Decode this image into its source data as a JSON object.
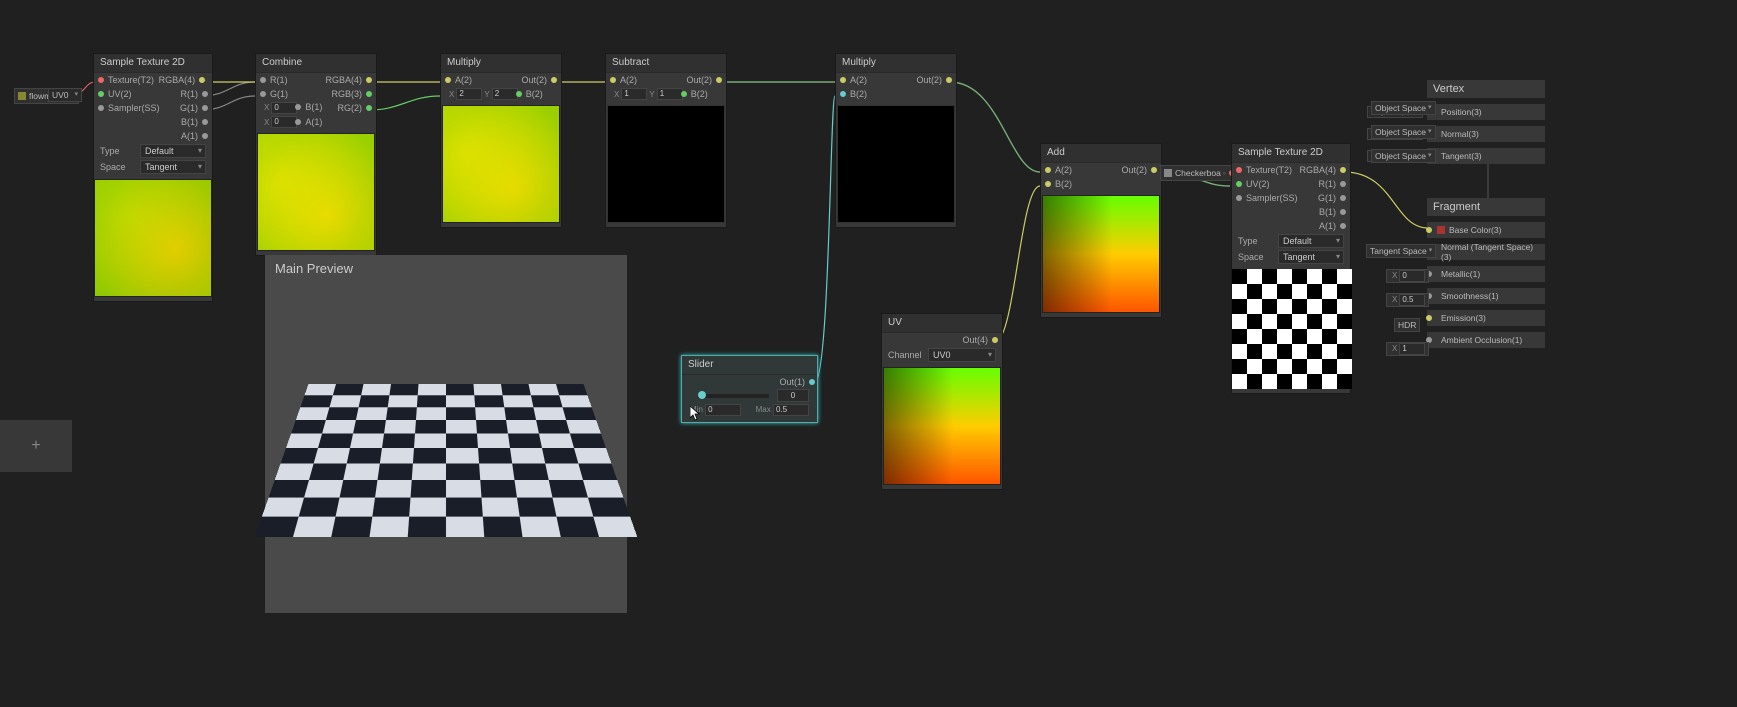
{
  "property_chip": {
    "label": "flowmap",
    "dd": "UV0"
  },
  "nodes": {
    "sample1": {
      "title": "Sample Texture 2D",
      "ports_in": [
        "Texture(T2)",
        "UV(2)",
        "Sampler(SS)"
      ],
      "ports_out": [
        "RGBA(4)",
        "R(1)",
        "G(1)",
        "B(1)",
        "A(1)"
      ],
      "type_lbl": "Type",
      "type_val": "Default",
      "space_lbl": "Space",
      "space_val": "Tangent"
    },
    "combine": {
      "title": "Combine",
      "ports_in": [
        "R(1)",
        "G(1)",
        "B(1)",
        "A(1)"
      ],
      "ports_out": [
        "RGBA(4)",
        "RGB(3)",
        "RG(2)"
      ],
      "x_lbl": "X",
      "x_val": "0"
    },
    "mul1": {
      "title": "Multiply",
      "ports_in": [
        "A(2)",
        "B(2)"
      ],
      "ports_out": [
        "Out(2)"
      ],
      "x_lbl": "X",
      "x_val": "2",
      "y_lbl": "Y",
      "y_val": "2"
    },
    "sub": {
      "title": "Subtract",
      "ports_in": [
        "A(2)",
        "B(2)"
      ],
      "ports_out": [
        "Out(2)"
      ],
      "x_lbl": "X",
      "x_val": "1",
      "y_lbl": "Y",
      "y_val": "1"
    },
    "mul2": {
      "title": "Multiply",
      "ports_in": [
        "A(2)",
        "B(2)"
      ],
      "ports_out": [
        "Out(2)"
      ]
    },
    "add": {
      "title": "Add",
      "ports_in": [
        "A(2)",
        "B(2)"
      ],
      "ports_out": [
        "Out(2)"
      ]
    },
    "uv": {
      "title": "UV",
      "ports_out": [
        "Out(4)"
      ],
      "channel_lbl": "Channel",
      "channel_val": "UV0"
    },
    "slider": {
      "title": "Slider",
      "out_lbl": "Out(1)",
      "value": "0",
      "min_lbl": "Min",
      "min_val": "0",
      "max_lbl": "Max",
      "max_val": "0.5"
    },
    "sample2": {
      "title": "Sample Texture 2D",
      "ports_in": [
        "Texture(T2)",
        "UV(2)",
        "Sampler(SS)"
      ],
      "ports_out": [
        "RGBA(4)",
        "R(1)",
        "G(1)",
        "B(1)",
        "A(1)"
      ],
      "type_lbl": "Type",
      "type_val": "Default",
      "space_lbl": "Space",
      "space_val": "Tangent"
    },
    "checker_chip": {
      "label": "Checkerboa"
    }
  },
  "vertex": {
    "title": "Vertex",
    "rows": [
      {
        "chip": "Object Space",
        "label": "Position(3)"
      },
      {
        "chip": "Object Space",
        "label": "Normal(3)"
      },
      {
        "chip": "Object Space",
        "label": "Tangent(3)"
      }
    ]
  },
  "fragment": {
    "title": "Fragment",
    "rows": [
      {
        "chip": "",
        "label": "Base Color(3)",
        "swatch": "#a33"
      },
      {
        "chip": "Tangent Space",
        "label": "Normal (Tangent Space)(3)"
      },
      {
        "chip": "X",
        "val": "0",
        "label": "Metallic(1)"
      },
      {
        "chip": "X",
        "val": "0.5",
        "label": "Smoothness(1)"
      },
      {
        "chip": "HDR",
        "label": "Emission(3)"
      },
      {
        "chip": "X",
        "val": "1",
        "label": "Ambient Occlusion(1)"
      }
    ]
  },
  "main_preview": {
    "title": "Main Preview"
  },
  "add_btn": "+"
}
